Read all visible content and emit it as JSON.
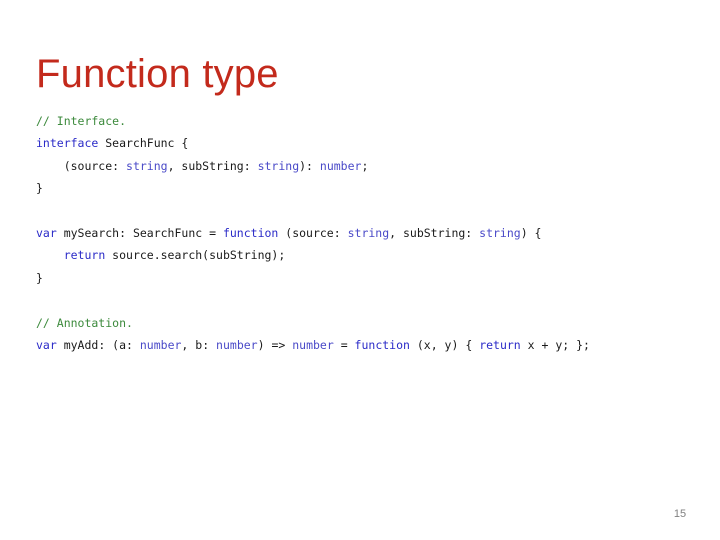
{
  "slide": {
    "title": "Function type",
    "title_color": "#c32a1c",
    "background_color": "#ffffff",
    "number": "15",
    "number_color": "#808080"
  },
  "syntax_colors": {
    "comment": "#3c8a3c",
    "keyword": "#2b2bc8",
    "type": "#4a4ac8",
    "plain": "#1a1a1a"
  },
  "code": {
    "lines": [
      {
        "tokens": [
          {
            "text": "// Interface.",
            "kind": "comment"
          }
        ]
      },
      {
        "tokens": [
          {
            "text": "interface",
            "kind": "keyword"
          },
          {
            "text": " SearchFunc {",
            "kind": "plain"
          }
        ]
      },
      {
        "tokens": [
          {
            "text": "    (source: ",
            "kind": "plain"
          },
          {
            "text": "string",
            "kind": "type"
          },
          {
            "text": ", subString: ",
            "kind": "plain"
          },
          {
            "text": "string",
            "kind": "type"
          },
          {
            "text": "): ",
            "kind": "plain"
          },
          {
            "text": "number",
            "kind": "type"
          },
          {
            "text": ";",
            "kind": "plain"
          }
        ]
      },
      {
        "tokens": [
          {
            "text": "}",
            "kind": "plain"
          }
        ]
      },
      {
        "tokens": []
      },
      {
        "tokens": [
          {
            "text": "var",
            "kind": "keyword"
          },
          {
            "text": " mySearch: SearchFunc = ",
            "kind": "plain"
          },
          {
            "text": "function",
            "kind": "keyword"
          },
          {
            "text": " (source: ",
            "kind": "plain"
          },
          {
            "text": "string",
            "kind": "type"
          },
          {
            "text": ", subString: ",
            "kind": "plain"
          },
          {
            "text": "string",
            "kind": "type"
          },
          {
            "text": ") {",
            "kind": "plain"
          }
        ]
      },
      {
        "tokens": [
          {
            "text": "    ",
            "kind": "plain"
          },
          {
            "text": "return",
            "kind": "keyword"
          },
          {
            "text": " source.search(subString);",
            "kind": "plain"
          }
        ]
      },
      {
        "tokens": [
          {
            "text": "}",
            "kind": "plain"
          }
        ]
      },
      {
        "tokens": []
      },
      {
        "tokens": [
          {
            "text": "// Annotation.",
            "kind": "comment"
          }
        ]
      },
      {
        "tokens": [
          {
            "text": "var",
            "kind": "keyword"
          },
          {
            "text": " myAdd: (a: ",
            "kind": "plain"
          },
          {
            "text": "number",
            "kind": "type"
          },
          {
            "text": ", b: ",
            "kind": "plain"
          },
          {
            "text": "number",
            "kind": "type"
          },
          {
            "text": ") => ",
            "kind": "plain"
          },
          {
            "text": "number",
            "kind": "type"
          },
          {
            "text": " = ",
            "kind": "plain"
          },
          {
            "text": "function",
            "kind": "keyword"
          },
          {
            "text": " (x, y) { ",
            "kind": "plain"
          },
          {
            "text": "return",
            "kind": "keyword"
          },
          {
            "text": " x + y; };",
            "kind": "plain"
          }
        ]
      }
    ]
  }
}
